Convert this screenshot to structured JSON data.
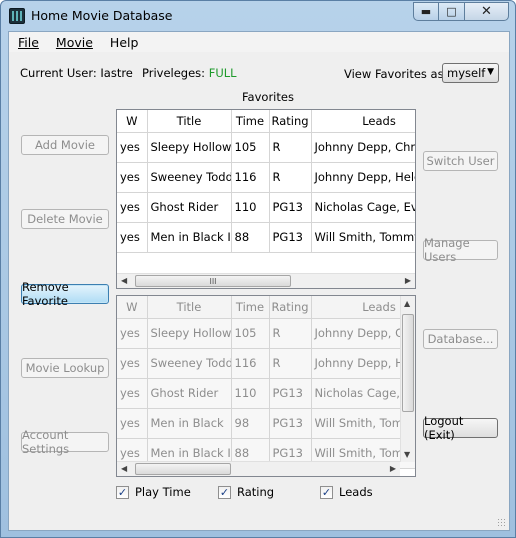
{
  "window": {
    "title": "Home Movie Database",
    "minimize": "▬",
    "maximize": "□",
    "close": "✕"
  },
  "menu": {
    "file": "File",
    "movie": "Movie",
    "help": "Help"
  },
  "user": {
    "current_label": "Current User: Iastre",
    "privileges_label": "Priveleges:",
    "privileges_value": "FULL",
    "privileges_color": "#1e9a2b"
  },
  "view_favorites": {
    "label": "View Favorites as:",
    "selected": "myself"
  },
  "favorites_label": "Favorites",
  "buttons": {
    "add_movie": "Add Movie",
    "delete_movie": "Delete Movie",
    "remove_favorite": "Remove Favorite",
    "movie_lookup": "Movie Lookup",
    "account_settings": "Account Settings",
    "switch_user": "Switch User",
    "manage_users": "Manage Users",
    "database": "Database...",
    "logout": "Logout (Exit)"
  },
  "columns": [
    "W",
    "Title",
    "Time",
    "Rating",
    "Leads"
  ],
  "favorites_rows": [
    [
      "yes",
      "Sleepy Hollow",
      "105",
      "R",
      "Johnny Depp, Christina Ricci"
    ],
    [
      "yes",
      "Sweeney Todd",
      "116",
      "R",
      "Johnny Depp, Helena Bonham Carter"
    ],
    [
      "yes",
      "Ghost Rider",
      "110",
      "PG13",
      "Nicholas Cage, Eva Mendes"
    ],
    [
      "yes",
      "Men in Black II",
      "88",
      "PG13",
      "Will Smith, Tommy Lee Jones"
    ]
  ],
  "all_rows": [
    [
      "yes",
      "Sleepy Hollow",
      "105",
      "R",
      "Johnny Depp, Christina Ricci"
    ],
    [
      "yes",
      "Sweeney Todd",
      "116",
      "R",
      "Johnny Depp, Helena Bonham Carter"
    ],
    [
      "yes",
      "Ghost Rider",
      "110",
      "PG13",
      "Nicholas Cage, Eva Mendes"
    ],
    [
      "yes",
      "Men in Black",
      "98",
      "PG13",
      "Will Smith, Tommy Lee Jones"
    ],
    [
      "yes",
      "Men in Black II",
      "88",
      "PG13",
      "Will Smith, Tommy Lee Jones"
    ]
  ],
  "checkboxes": [
    {
      "label": "Play Time",
      "checked": true
    },
    {
      "label": "Rating",
      "checked": true
    },
    {
      "label": "Leads",
      "checked": true
    }
  ],
  "scroll_glyphs": {
    "left": "◀",
    "right": "▶",
    "up": "▲",
    "down": "▼",
    "grip": "III"
  },
  "check_glyph": "✓"
}
